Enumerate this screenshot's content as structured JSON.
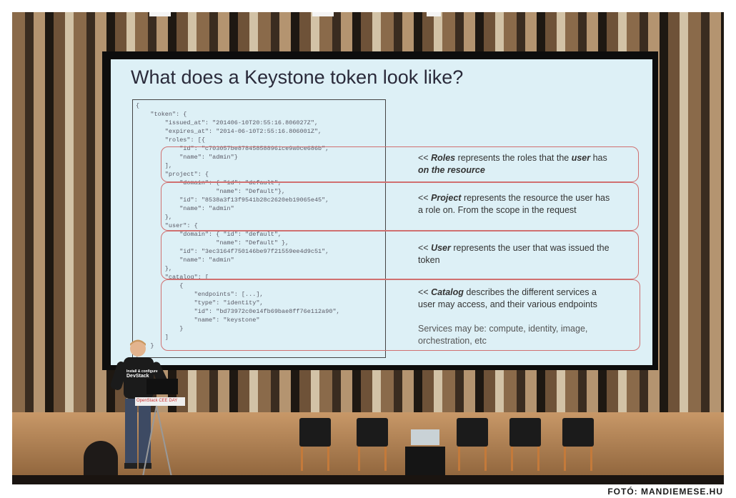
{
  "slide": {
    "title": "What does a Keystone token look like?",
    "code_lines": [
      "{",
      "    \"token\": {",
      "        \"issued_at\": \"201406-10T20:55:16.806027Z\",",
      "        \"expires_at\": \"2014-06-10T2:55:16.806001Z\",",
      "        \"roles\": [{",
      "            \"id\": \"c703057be878458588961ce9a0ce686b\",",
      "            \"name\": \"admin\"}",
      "        ],",
      "        \"project\": {",
      "            \"domain\": { \"id\": \"default\",",
      "                      \"name\": \"Default\"},",
      "            \"id\": \"8538a3f13f9541b28c2620eb19065e45\",",
      "            \"name\": \"admin\"",
      "        },",
      "        \"user\": {",
      "            \"domain\": { \"id\": \"default\",",
      "                      \"name\": \"Default\" },",
      "            \"id\": \"3ec3164f750146be97f21559ee4d9c51\",",
      "            \"name\": \"admin\"",
      "        },",
      "        \"catalog\": [",
      "            {",
      "                \"endpoints\": [...],",
      "                \"type\": \"identity\",",
      "                \"id\": \"bd73972c0e14fb69bae8ff76e112a90\",",
      "                \"name\": \"keystone\"",
      "            }",
      "        ]",
      "    }",
      "}"
    ],
    "notes": [
      {
        "prefix": "<< ",
        "term": "Roles",
        "text": " represents the roles that the ",
        "term2": "user",
        "text2": " has",
        "line2": "on the resource"
      },
      {
        "prefix": "<< ",
        "term": "Project",
        "text": " represents the resource the user has",
        "line2": "a role on. From the scope in the request"
      },
      {
        "prefix": "<< ",
        "term": "User",
        "text": " represents the user that was issued the",
        "line2": "token"
      },
      {
        "prefix": "<< ",
        "term": "Catalog",
        "text": " describes the different services a",
        "line2": "user may access, and their various endpoints",
        "line3": "Services may be: compute, identity, image,",
        "line4": "orchestration, etc"
      }
    ]
  },
  "speaker": {
    "shirt_text_1": "Install & configure",
    "shirt_text_2": "DevStack",
    "podium_label": "OpenStack CEE DAY"
  },
  "credit": "FOTÓ: MANDIEMESE.HU",
  "colors": {
    "slide_bg": "#ddf0f6",
    "highlight_border": "#d07070",
    "wood": "#c89868"
  }
}
